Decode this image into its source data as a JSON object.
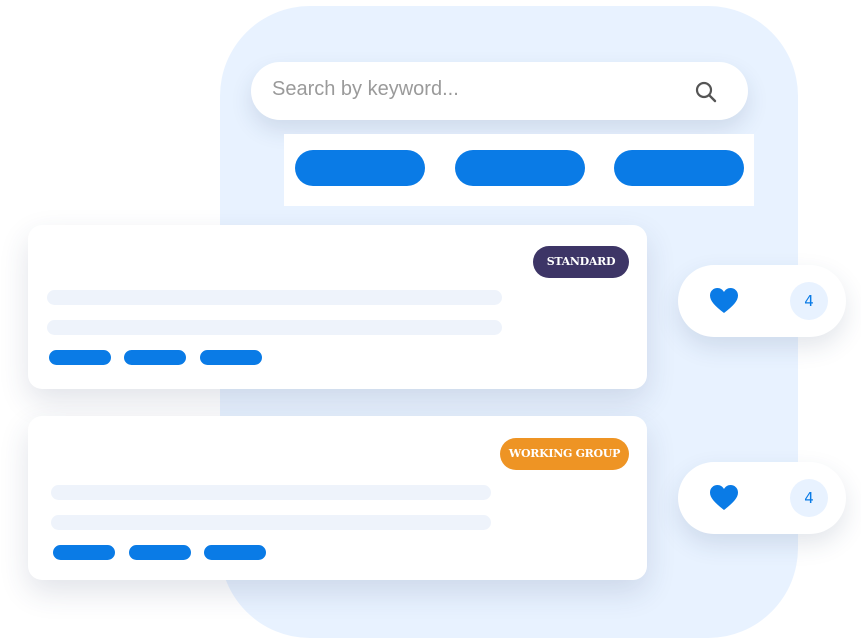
{
  "search": {
    "placeholder": "Search by keyword...",
    "icon": "search-icon"
  },
  "filters": {
    "pill_color": "#0a7be6",
    "count": 3
  },
  "cards": [
    {
      "badge": "STANDARD",
      "badge_color": "#3d3566",
      "likes": "4"
    },
    {
      "badge": "WORKING GROUP",
      "badge_color": "#ee9424",
      "likes": "4"
    }
  ],
  "colors": {
    "accent": "#0a7be6",
    "panel_background": "#e8f2ff",
    "placeholder_line": "#eef3fb"
  },
  "icons": {
    "like": "heart-icon",
    "search": "search-icon"
  }
}
